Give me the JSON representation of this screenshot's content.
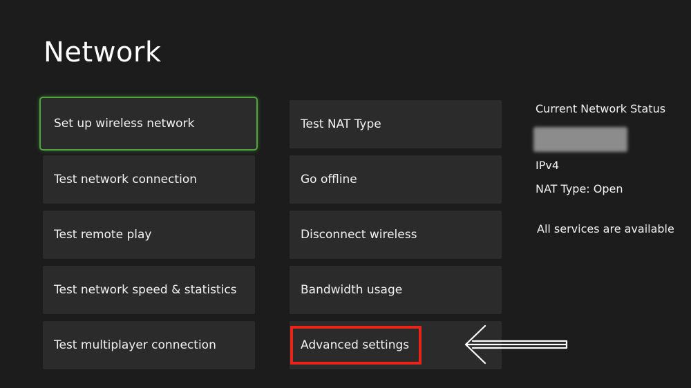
{
  "page": {
    "title": "Network"
  },
  "menu": {
    "left_column": [
      {
        "label": "Set up wireless network",
        "focused": true
      },
      {
        "label": "Test network connection"
      },
      {
        "label": "Test remote play"
      },
      {
        "label": "Test network speed & statistics"
      },
      {
        "label": "Test multiplayer connection"
      }
    ],
    "right_column": [
      {
        "label": "Test NAT Type"
      },
      {
        "label": "Go offline"
      },
      {
        "label": "Disconnect wireless"
      },
      {
        "label": "Bandwidth usage"
      },
      {
        "label": "Advanced settings",
        "highlighted": true
      }
    ]
  },
  "status": {
    "title": "Current Network Status",
    "ip_address": "",
    "ip_version": "IPv4",
    "nat_type": "NAT Type: Open",
    "services": "All services are available"
  },
  "colors": {
    "background": "#1c1c1c",
    "tile": "#2b2b2b",
    "focus_border": "#4fa63a",
    "highlight_box": "#e8251b",
    "arrow": "#ffffff"
  },
  "icons": {
    "annotation_arrow": "left-arrow-icon"
  }
}
